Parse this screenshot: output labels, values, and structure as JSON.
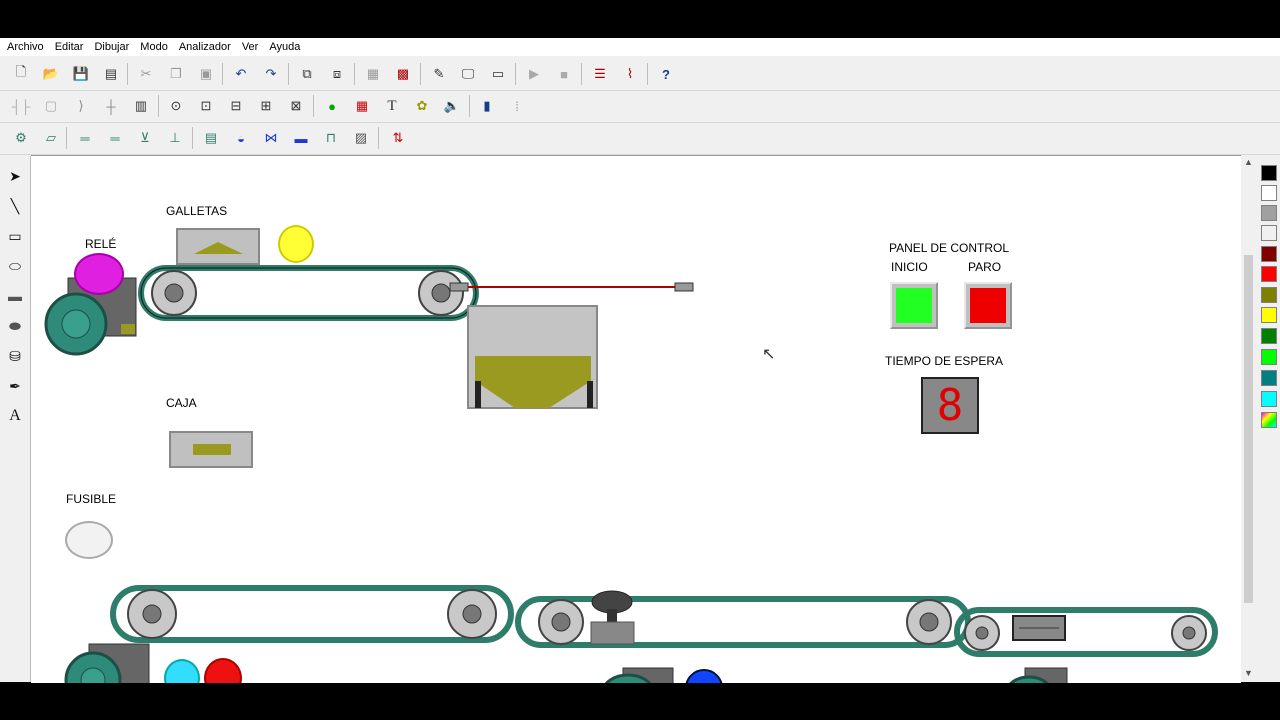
{
  "menu": [
    "Archivo",
    "Editar",
    "Dibujar",
    "Modo",
    "Analizador",
    "Ver",
    "Ayuda"
  ],
  "toolbar1": [
    "new-file-icon",
    "open-folder-icon",
    "save-icon",
    "print-icon",
    "cut-icon",
    "copy-icon",
    "paste-icon",
    "undo-icon",
    "redo-icon",
    "group-icon",
    "ungroup-icon",
    "grid-icon",
    "clear-grid-icon",
    "pencil-icon",
    "monitor-icon",
    "window-icon",
    "play-icon",
    "stop-icon",
    "analyzer-icon",
    "graph-icon",
    "help-icon"
  ],
  "toolbar2": [
    "contact-icon",
    "coil-icon",
    "arc-icon",
    "cross-icon",
    "block-icon",
    "timer-icon",
    "counter-icon",
    "compare-icon",
    "move-icon",
    "math-icon",
    "lamp-icon",
    "display-icon",
    "text-icon",
    "sound-icon",
    "speaker-icon",
    "level-icon",
    "dots-icon"
  ],
  "toolbar3": [
    "motor-icon",
    "conveyor-icon",
    "belt-icon",
    "belt2-icon",
    "valve-icon",
    "scale-icon",
    "tank-icon",
    "sensor-icon",
    "gate-icon",
    "bar-icon",
    "piston-icon",
    "grate-icon",
    "io-icon"
  ],
  "tools": [
    "arrow-tool",
    "line-tool",
    "rectangle-tool",
    "ellipse-tool",
    "filled-rect-tool",
    "filled-ellipse-tool",
    "bucket-tool",
    "picker-tool",
    "text-tool"
  ],
  "palette": [
    "#000000",
    "#ffffff",
    "#a0a0a0",
    "#f0f0f0",
    "#800000",
    "#ff0000",
    "#808000",
    "#ffff00",
    "#008000",
    "#00ff00",
    "#008080",
    "#00ffff",
    "multi"
  ],
  "canvas": {
    "rele_label": "RELÉ",
    "galletas_label": "GALLETAS",
    "caja_label": "CAJA",
    "fusible_label": "FUSIBLE",
    "panel_title": "PANEL DE CONTROL",
    "inicio_label": "INICIO",
    "paro_label": "PARO",
    "tiempo_label": "TIEMPO DE ESPERA",
    "display_value": "8"
  },
  "colors": {
    "rele_lamp": "#e020e0",
    "galletas_lamp": "#ffff33",
    "fusible_lamp": "#f2f2f2",
    "cyan_lamp": "#33ddff",
    "red_lamp": "#ee1111",
    "blue_lamp": "#1144ff",
    "inicio_button": "#22ff22",
    "paro_button": "#ee0000",
    "belt": "#2e7d6b",
    "hopper_fill": "#9a9a20"
  }
}
